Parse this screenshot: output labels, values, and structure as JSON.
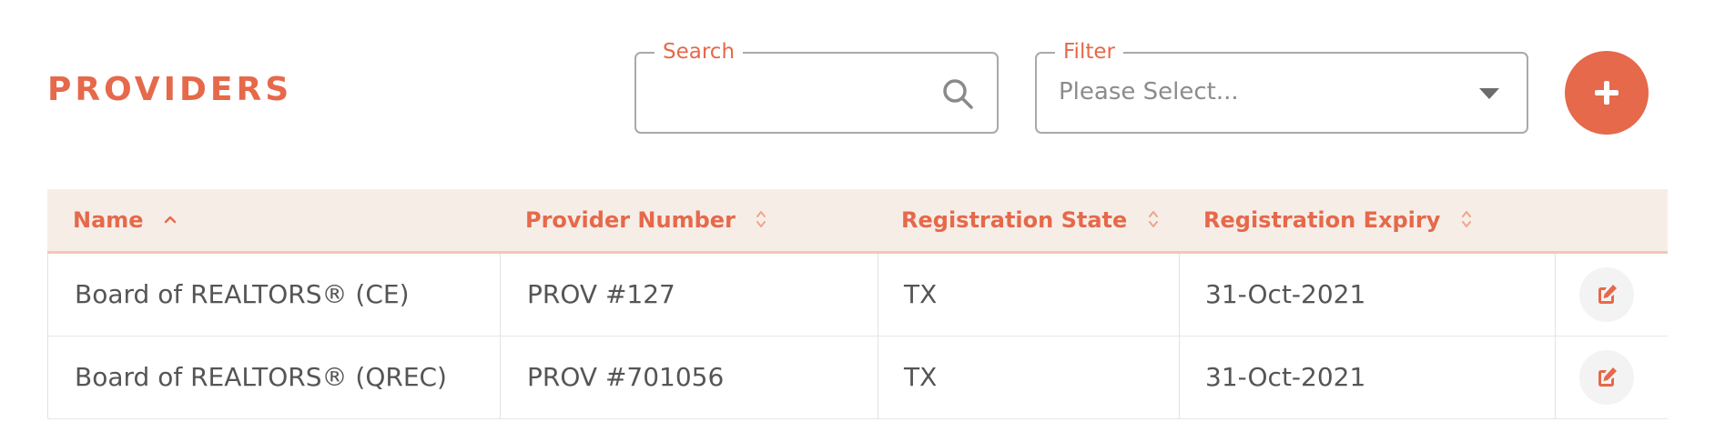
{
  "header": {
    "title": "PROVIDERS"
  },
  "search": {
    "label": "Search",
    "value": "",
    "icon": "search-icon"
  },
  "filter": {
    "label": "Filter",
    "selected": "Please Select...",
    "icon": "chevron-down-icon"
  },
  "add_button": {
    "icon": "plus-icon"
  },
  "colors": {
    "accent": "#E5694A",
    "header_bg": "#F7EDE7",
    "text": "#555555"
  },
  "table": {
    "columns": [
      {
        "label": "Name",
        "sort": "ascending"
      },
      {
        "label": "Provider Number",
        "sort": "none"
      },
      {
        "label": "Registration State",
        "sort": "none"
      },
      {
        "label": "Registration Expiry",
        "sort": "none"
      }
    ],
    "rows": [
      {
        "name": "Board of REALTORS® (CE)",
        "provider_number": "PROV #127",
        "state": "TX",
        "expiry": "31-Oct-2021"
      },
      {
        "name": "Board of REALTORS® (QREC)",
        "provider_number": "PROV #701056",
        "state": "TX",
        "expiry": "31-Oct-2021"
      }
    ]
  }
}
